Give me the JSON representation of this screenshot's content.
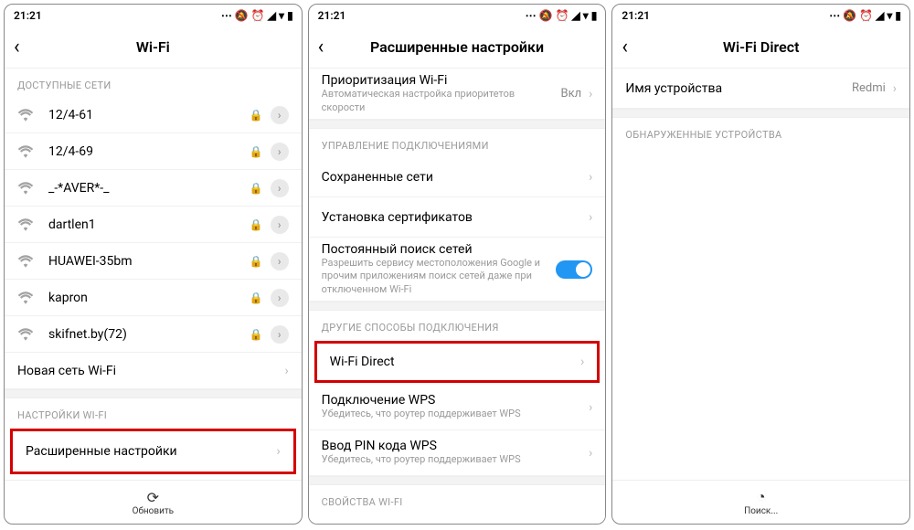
{
  "status_time": "21:21",
  "screens": {
    "s1": {
      "title": "Wi-Fi",
      "section_available": "ДОСТУПНЫЕ СЕТИ",
      "networks": [
        {
          "name": "12/4-61",
          "locked": true
        },
        {
          "name": "12/4-69",
          "locked": true
        },
        {
          "name": "_-*AVER*-_",
          "locked": true
        },
        {
          "name": "dartlen1",
          "locked": true
        },
        {
          "name": "HUAWEI-35bm",
          "locked": true
        },
        {
          "name": "kapron",
          "locked": true
        },
        {
          "name": "skifnet.by(72)",
          "locked": true
        }
      ],
      "new_network": "Новая сеть Wi-Fi",
      "section_settings": "НАСТРОЙКИ WI-FI",
      "advanced": "Расширенные настройки",
      "footer": "Обновить"
    },
    "s2": {
      "title": "Расширенные настройки",
      "prio": {
        "label": "Приоритизация Wi-Fi",
        "sub": "Автоматическая настройка приоритетов скорости",
        "value": "Вкл"
      },
      "section_conn": "УПРАВЛЕНИЕ ПОДКЛЮЧЕНИЯМИ",
      "saved": "Сохраненные сети",
      "cert": "Установка сертификатов",
      "scan": {
        "label": "Постоянный поиск сетей",
        "sub": "Разрешить сервису местоположения Google и прочим приложениям поиск сетей даже при отключенном Wi-Fi"
      },
      "section_other": "ДРУГИЕ СПОСОБЫ ПОДКЛЮЧЕНИЯ",
      "direct": "Wi-Fi Direct",
      "wps": {
        "label": "Подключение WPS",
        "sub": "Убедитесь, что роутер поддерживает WPS"
      },
      "wps_pin": {
        "label": "Ввод PIN кода WPS",
        "sub": "Убедитесь, что роутер поддерживает WPS"
      },
      "section_props": "СВОЙСТВА WI-FI"
    },
    "s3": {
      "title": "Wi-Fi Direct",
      "device_name": {
        "label": "Имя устройства",
        "value": "Redmi"
      },
      "section_found": "ОБНАРУЖЕННЫЕ УСТРОЙСТВА",
      "footer": "Поиск..."
    }
  }
}
